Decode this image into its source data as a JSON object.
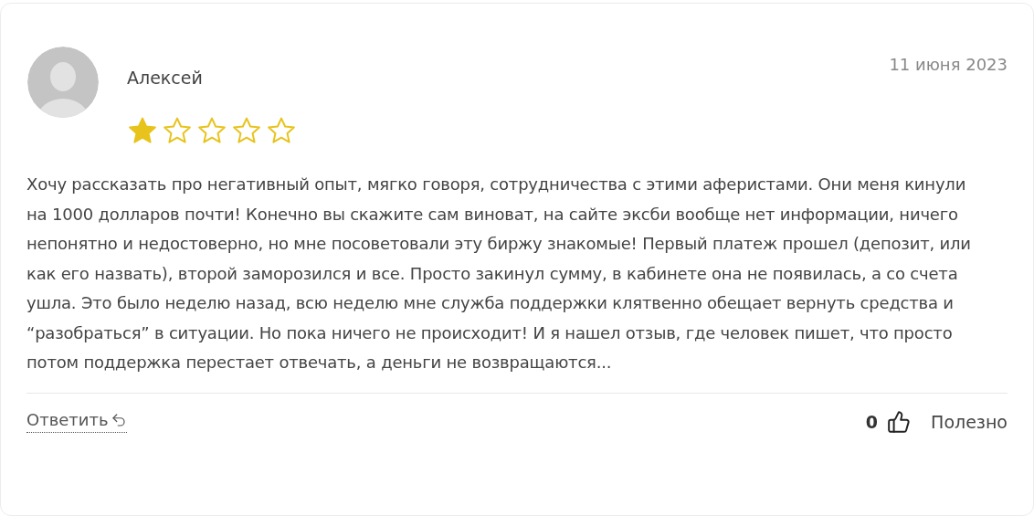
{
  "review": {
    "author": "Алексей",
    "date": "11 июня 2023",
    "stars": 1,
    "text": "Хочу рассказать про негативный опыт, мягко говоря, сотрудничества с этими аферистами. Они меня кинули на 1000 долларов почти! Конечно вы скажите сам виноват, на сайте эксби вообще нет информации, ничего непонятно и недостоверно, но мне посоветовали эту биржу знакомые! Первый платеж прошел (депозит, или как его назвать), второй заморозился и все. Просто закинул сумму, в кабинете она не появилась, а со счета ушла. Это было неделю назад, всю неделю мне служба поддержки клятвенно обещает вернуть средства и “разобраться” в ситуации. Но пока ничего не происходит! И я нашел отзыв, где человек пишет, что просто потом поддержка перестает отвечать, а деньги не возвращаются...",
    "reply": "Ответить",
    "likes": "0",
    "helpful": "Полезно"
  }
}
